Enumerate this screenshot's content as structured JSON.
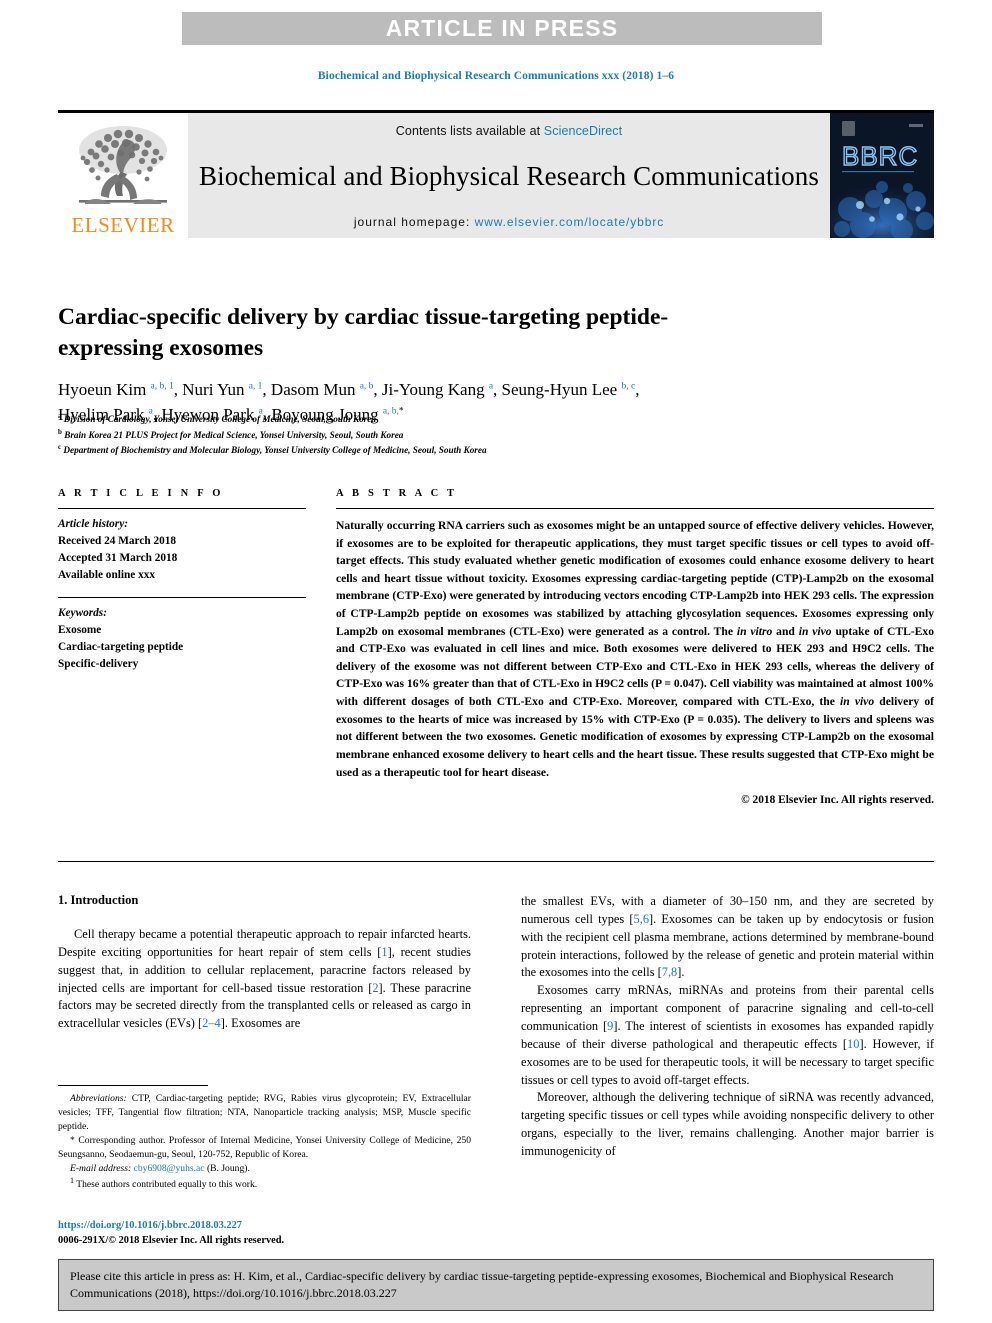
{
  "banner": {
    "label": "ARTICLE IN PRESS"
  },
  "running_head": "Biochemical and Biophysical Research Communications xxx (2018) 1–6",
  "masthead": {
    "contents_prefix": "Contents lists available at ",
    "sciencedirect": "ScienceDirect",
    "journal_name": "Biochemical and Biophysical Research Communications",
    "homepage_prefix": "journal homepage: ",
    "homepage_url": "www.elsevier.com/locate/ybbrc",
    "publisher_wordmark": "ELSEVIER",
    "cover_wordmark": "BBRC",
    "link_color": "#1a7bb9",
    "elsevier_orange": "#F08C1E"
  },
  "article": {
    "title": "Cardiac-specific delivery by cardiac tissue-targeting peptide-expressing exosomes",
    "authors_line_1": "Hyoeun Kim a, b, 1, Nuri Yun a, 1, Dasom Mun a, b, Ji-Young Kang a, Seung-Hyun Lee b, c,",
    "authors_line_2": "Hyelim Park a, Hyewon Park a, Boyoung Joung a, b, *",
    "affiliations": [
      {
        "marker": "a",
        "text": "Division of Cardiology, Yonsei University College of Medicine, Seoul, South Korea"
      },
      {
        "marker": "b",
        "text": "Brain Korea 21 PLUS Project for Medical Science, Yonsei University, Seoul, South Korea"
      },
      {
        "marker": "c",
        "text": "Department of Biochemistry and Molecular Biology, Yonsei University College of Medicine, Seoul, South Korea"
      }
    ]
  },
  "article_info": {
    "heading": "A R T I C L E  I N F O",
    "history_label": "Article history:",
    "received": "Received 24 March 2018",
    "accepted": "Accepted 31 March 2018",
    "online": "Available online xxx",
    "keywords_label": "Keywords:",
    "keywords": [
      "Exosome",
      "Cardiac-targeting peptide",
      "Specific-delivery"
    ]
  },
  "abstract": {
    "heading": "A B S T R A C T",
    "text": "Naturally occurring RNA carriers such as exosomes might be an untapped source of effective delivery vehicles. However, if exosomes are to be exploited for therapeutic applications, they must target specific tissues or cell types to avoid off-target effects. This study evaluated whether genetic modification of exosomes could enhance exosome delivery to heart cells and heart tissue without toxicity. Exosomes expressing cardiac-targeting peptide (CTP)-Lamp2b on the exosomal membrane (CTP-Exo) were generated by introducing vectors encoding CTP-Lamp2b into HEK 293 cells. The expression of CTP-Lamp2b peptide on exosomes was stabilized by attaching glycosylation sequences. Exosomes expressing only Lamp2b on exosomal membranes (CTL-Exo) were generated as a control. The in vitro and in vivo uptake of CTL-Exo and CTP-Exo was evaluated in cell lines and mice. Both exosomes were delivered to HEK 293 and H9C2 cells. The delivery of the exosome was not different between CTP-Exo and CTL-Exo in HEK 293 cells, whereas the delivery of CTP-Exo was 16% greater than that of CTL-Exo in H9C2 cells (P = 0.047). Cell viability was maintained at almost 100% with different dosages of both CTL-Exo and CTP-Exo. Moreover, compared with CTL-Exo, the in vivo delivery of exosomes to the hearts of mice was increased by 15% with CTP-Exo (P = 0.035). The delivery to livers and spleens was not different between the two exosomes. Genetic modification of exosomes by expressing CTP-Lamp2b on the exosomal membrane enhanced exosome delivery to heart cells and the heart tissue. These results suggested that CTP-Exo might be used as a therapeutic tool for heart disease.",
    "copyright": "© 2018 Elsevier Inc. All rights reserved."
  },
  "introduction": {
    "heading": "1. Introduction",
    "left_paragraph_1": "Cell therapy became a potential therapeutic approach to repair infarcted hearts. Despite exciting opportunities for heart repair of stem cells [1], recent studies suggest that, in addition to cellular replacement, paracrine factors released by injected cells are important for cell-based tissue restoration [2]. These paracrine factors may be secreted directly from the transplanted cells or released as cargo in extracellular vesicles (EVs) [2–4]. Exosomes are",
    "right_paragraph_1": "the smallest EVs, with a diameter of 30–150 nm, and they are secreted by numerous cell types [5,6]. Exosomes can be taken up by endocytosis or fusion with the recipient cell plasma membrane, actions determined by membrane-bound protein interactions, followed by the release of genetic and protein material within the exosomes into the cells [7,8].",
    "right_paragraph_2": "Exosomes carry mRNAs, miRNAs and proteins from their parental cells representing an important component of paracrine signaling and cell-to-cell communication [9]. The interest of scientists in exosomes has expanded rapidly because of their diverse pathological and therapeutic effects [10]. However, if exosomes are to be used for therapeutic tools, it will be necessary to target specific tissues or cell types to avoid off-target effects.",
    "right_paragraph_3": "Moreover, although the delivering technique of siRNA was recently advanced, targeting specific tissues or cell types while avoiding nonspecific delivery to other organs, especially to the liver, remains challenging. Another major barrier is immunogenicity of"
  },
  "footnotes": {
    "abbreviations_label": "Abbreviations:",
    "abbreviations_text": "CTP, Cardiac-targeting peptide; RVG, Rabies virus glycoprotein; EV, Extracellular vesicles; TFF, Tangential flow filtration; NTA, Nanoparticle tracking analysis; MSP, Muscle specific peptide.",
    "corresponding_marker": "*",
    "corresponding_text": "Corresponding author. Professor of Internal Medicine, Yonsei University College of Medicine, 250 Seungsanno, Seodaemun-gu, Seoul, 120-752, Republic of Korea.",
    "email_label": "E-mail address:",
    "email": "cby6908@yuhs.ac",
    "email_suffix": "(B. Joung).",
    "equal_marker": "1",
    "equal_text": "These authors contributed equally to this work."
  },
  "doi_block": {
    "doi": "https://doi.org/10.1016/j.bbrc.2018.03.227",
    "issn_line": "0006-291X/© 2018 Elsevier Inc. All rights reserved."
  },
  "cite_box": {
    "text": "Please cite this article in press as: H. Kim, et al., Cardiac-specific delivery by cardiac tissue-targeting peptide-expressing exosomes, Biochemical and Biophysical Research Communications (2018), https://doi.org/10.1016/j.bbrc.2018.03.227"
  }
}
